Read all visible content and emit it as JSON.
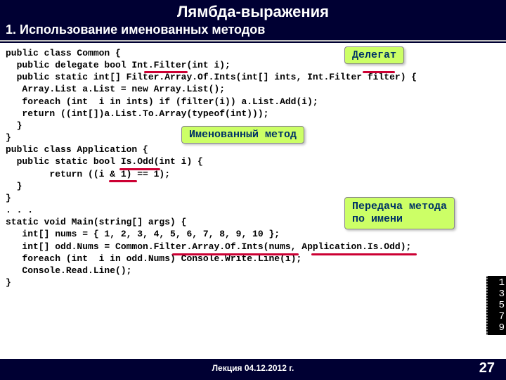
{
  "header": {
    "title": "Лямбда-выражения",
    "subtitle": "1. Использование именованных методов"
  },
  "code": {
    "l01": "public class Common {",
    "l02": "  public delegate bool Int.Filter(int i);",
    "l03": "  public static int[] Filter.Array.Of.Ints(int[] ints, Int.Filter filter) {",
    "l04": "   Array.List a.List = new Array.List();",
    "l05": "   foreach (int  i in ints) if (filter(i)) a.List.Add(i);",
    "l06": "   return ((int[])a.List.To.Array(typeof(int)));",
    "l07": "  }",
    "l08": "}",
    "l09": "public class Application {",
    "l10": "  public static bool Is.Odd(int i) {",
    "l11": "        return ((i & 1) == 1);",
    "l12": "  }",
    "l13": "}",
    "l14": ". . .",
    "l15": "static void Main(string[] args) {",
    "l16": "   int[] nums = { 1, 2, 3, 4, 5, 6, 7, 8, 9, 10 };",
    "l17": "   int[] odd.Nums = Common.Filter.Array.Of.Ints(nums, Application.Is.Odd);",
    "l18": "   foreach (int  i in odd.Nums) Console.Write.Line(i);",
    "l19": "   Console.Read.Line();",
    "l20": "}"
  },
  "labels": {
    "delegate": "Делегат",
    "named_method": "Именованный метод",
    "pass_by_name_1": "Передача метода",
    "pass_by_name_2": "по имени"
  },
  "output": {
    "r1": "1",
    "r2": "3",
    "r3": "5",
    "r4": "7",
    "r5": "9"
  },
  "footer": {
    "lecture": "Лекция 04.12.2012 г.",
    "page": "27"
  }
}
